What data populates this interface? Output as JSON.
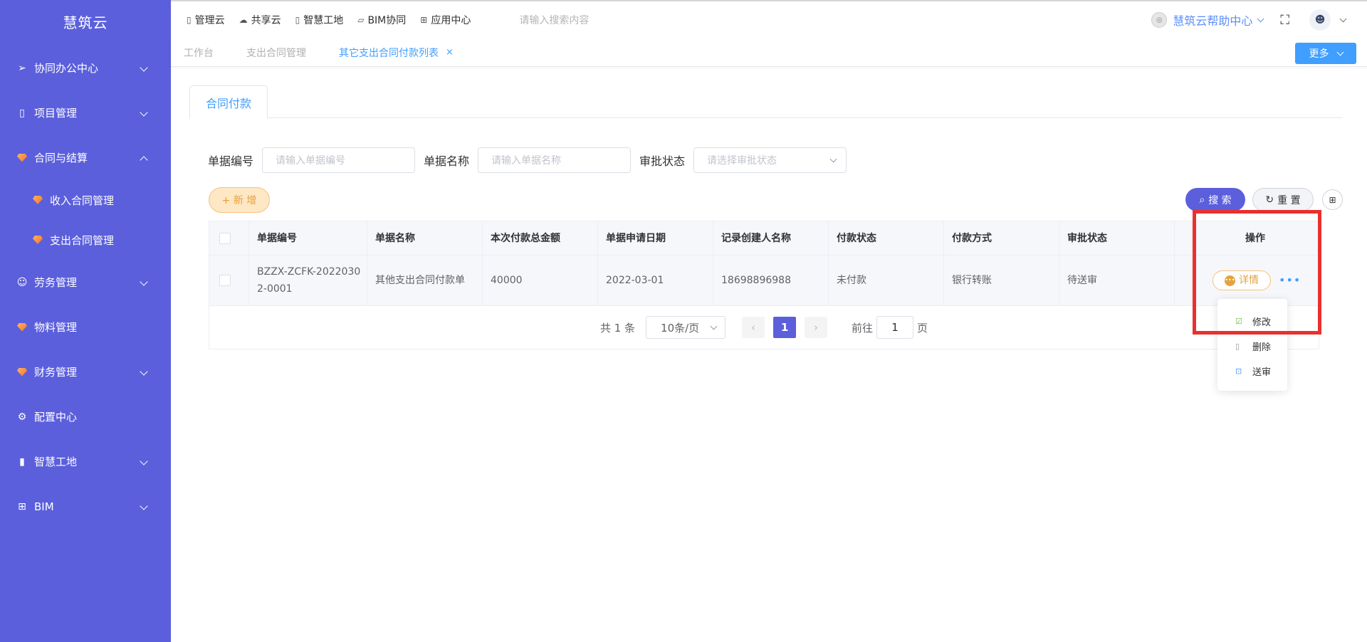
{
  "brand": "慧筑云",
  "sidebar": {
    "items": [
      {
        "label": "协同办公中心",
        "icon": "send-icon"
      },
      {
        "label": "项目管理",
        "icon": "book-icon"
      },
      {
        "label": "合同与结算",
        "icon": "diamond-icon"
      },
      {
        "label": "收入合同管理",
        "icon": "diamond-icon"
      },
      {
        "label": "支出合同管理",
        "icon": "diamond-icon"
      },
      {
        "label": "劳务管理",
        "icon": "user-icon"
      },
      {
        "label": "物料管理",
        "icon": "diamond-icon"
      },
      {
        "label": "财务管理",
        "icon": "diamond-icon"
      },
      {
        "label": "配置中心",
        "icon": "gear-icon"
      },
      {
        "label": "智慧工地",
        "icon": "bar-chart-icon"
      },
      {
        "label": "BIM",
        "icon": "grid-icon"
      }
    ]
  },
  "topnav": {
    "items": [
      "管理云",
      "共享云",
      "智慧工地",
      "BIM协同",
      "应用中心"
    ],
    "search_placeholder": "请输入搜索内容",
    "help": "慧筑云帮助中心"
  },
  "tabs": {
    "items": [
      "工作台",
      "支出合同管理",
      "其它支出合同付款列表"
    ],
    "close": "×",
    "more": "更多"
  },
  "subtab": "合同付款",
  "filters": {
    "code_label": "单据编号",
    "code_placeholder": "请输入单据编号",
    "name_label": "单据名称",
    "name_placeholder": "请输入单据名称",
    "status_label": "审批状态",
    "status_placeholder": "请选择审批状态"
  },
  "buttons": {
    "add": "+ 新 增",
    "search": "搜 索",
    "reset": "重 置"
  },
  "table": {
    "columns": [
      "单据编号",
      "单据名称",
      "本次付款总金额",
      "单据申请日期",
      "记录创建人名称",
      "付款状态",
      "付款方式",
      "审批状态",
      "",
      "操作"
    ],
    "rows": [
      [
        "BZZX-ZCFK-20220302-0001",
        "其他支出合同付款单",
        "40000",
        "2022-03-01",
        "18698896988",
        "未付款",
        "银行转账",
        "待送审"
      ]
    ],
    "detail": "详情"
  },
  "pager": {
    "total": "共 1 条",
    "size": "10条/页",
    "page": "1",
    "goto_pre": "前往",
    "goto_val": "1",
    "goto_post": "页"
  },
  "dropdown": [
    "修改",
    "删除",
    "送审"
  ],
  "colors": {
    "sidebar": "#5b5fdc",
    "accent": "#409eff",
    "warning": "#e6a23c",
    "highlight": "#e8312f"
  }
}
